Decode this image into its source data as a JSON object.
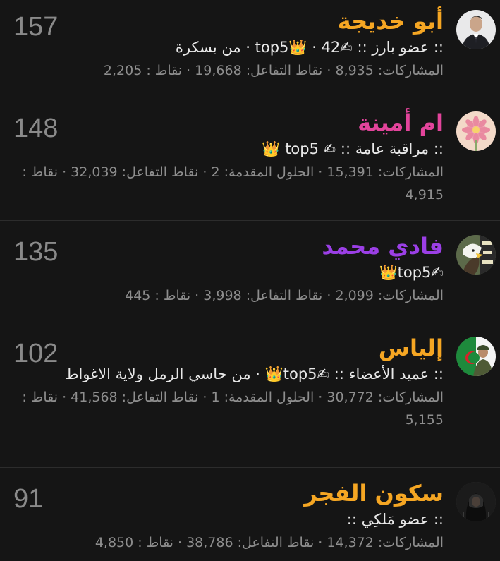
{
  "members": [
    {
      "name": "أبو خديجة",
      "name_color": "#f5a623",
      "title_line": ":: عضو بارز :: ✍top5👑 · 42 · من بسكرة",
      "stats_line": "المشاركات: 8,935 · نقاط التفاعل: 19,668 · نقاط : 2,205",
      "count": "157",
      "avatar_icon": "man-in-suit-avatar"
    },
    {
      "name": "ام أمينة",
      "name_color": "#e3449b",
      "title_line": ":: مراقبة عامة :: ✍ top5 👑",
      "stats_line": "المشاركات: 15,391 · الحلول المقدمة: 2 · نقاط التفاعل: 32,039 · نقاط : 4,915",
      "count": "148",
      "avatar_icon": "pink-flower-avatar"
    },
    {
      "name": "فادي محمد",
      "name_color": "#9b3fe6",
      "title_line": "✍top5👑",
      "stats_line": "المشاركات: 2,099 · نقاط التفاعل: 3,998 · نقاط : 445",
      "count": "135",
      "avatar_icon": "eagle-avatar"
    },
    {
      "name": "إلياس",
      "name_color": "#f5a623",
      "title_line": ":: عميد الأعضاء :: ✍top5👑 · من حاسي الرمل ولاية الاغواط",
      "stats_line": "المشاركات: 30,772 · الحلول المقدمة: 1 · نقاط التفاعل: 41,568 · نقاط : 5,155",
      "count": "102",
      "avatar_icon": "algeria-flag-soldier-avatar"
    },
    {
      "name": "سكون الفجر",
      "name_color": "#f5a623",
      "title_line": ":: عضو مَلكِي ::",
      "stats_line": "المشاركات: 14,372 · نقاط التفاعل: 38,786 · نقاط : 4,850",
      "count": "91",
      "avatar_icon": "hooded-figure-avatar"
    }
  ]
}
